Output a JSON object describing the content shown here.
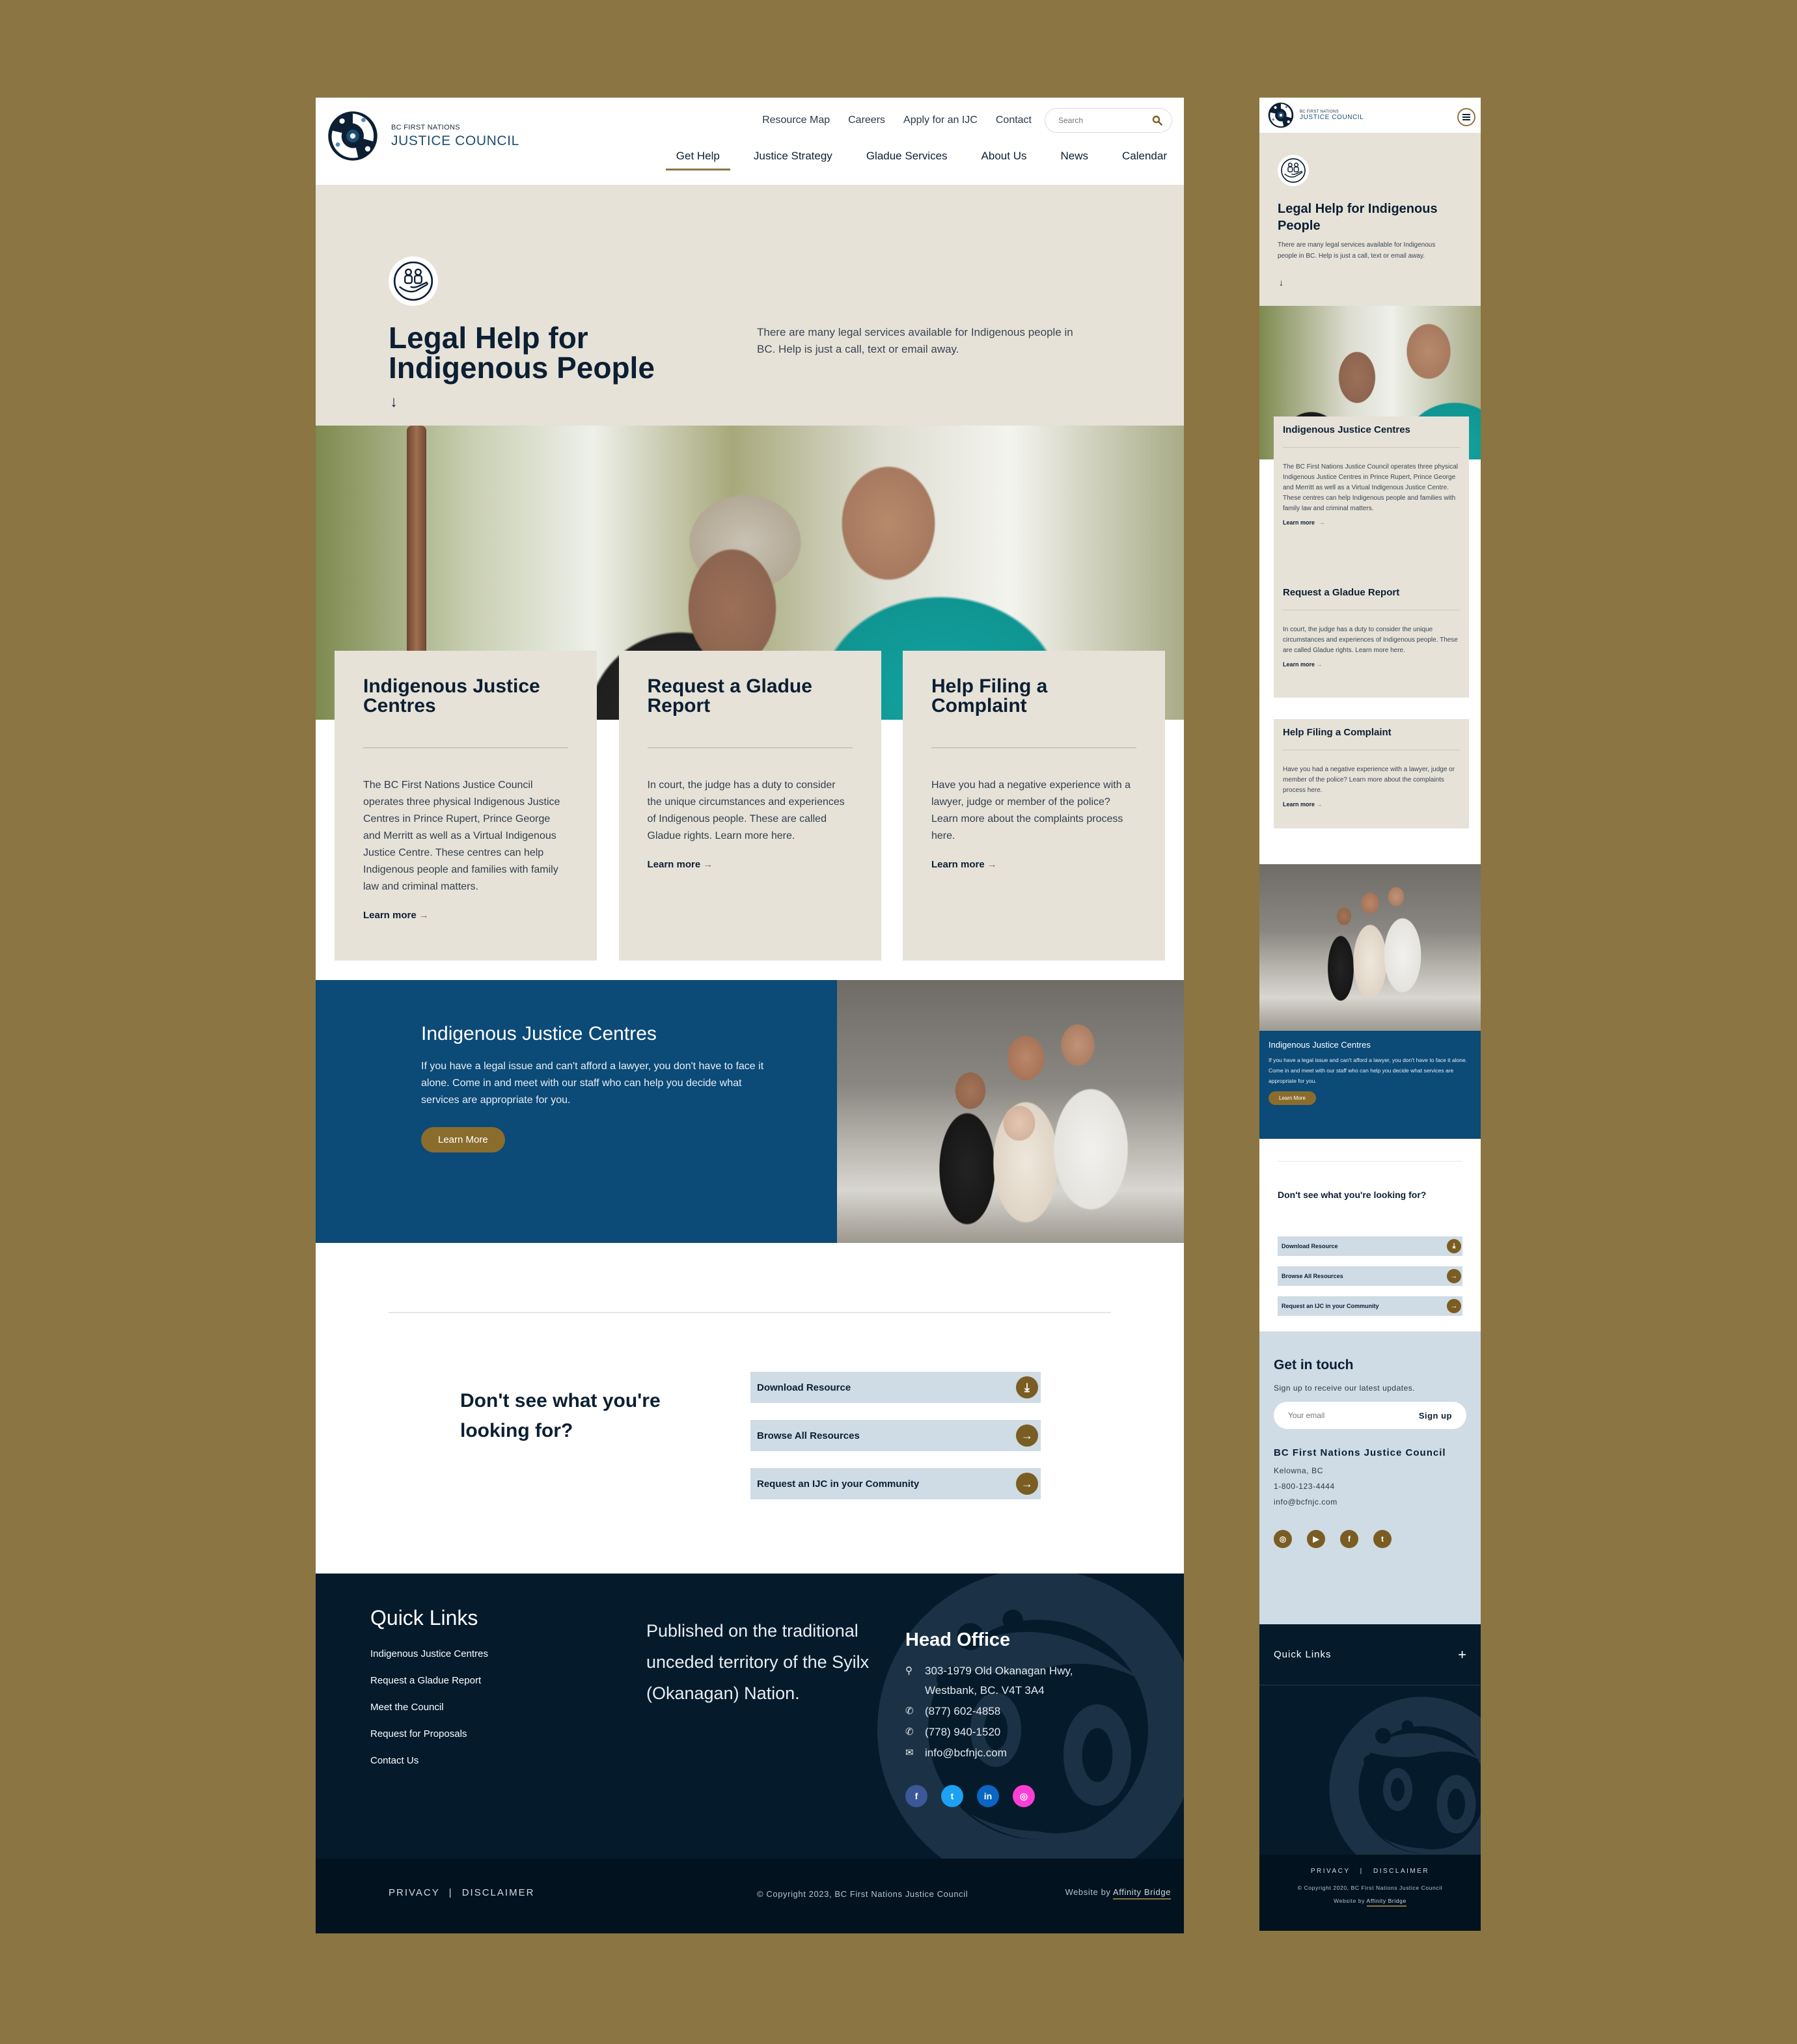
{
  "brand": {
    "line1": "BC FIRST NATIONS",
    "line2": "JUSTICE COUNCIL"
  },
  "colors": {
    "frame": "#8a7543",
    "navy": "#0c1f33",
    "blue_band": "#0c4a77",
    "beige": "#e6e2d8",
    "gold": "#8a6d2d",
    "light_blue": "#cfdbe5",
    "footer_dark": "#051b2c"
  },
  "utility_nav": [
    "Resource Map",
    "Careers",
    "Apply for an IJC",
    "Contact"
  ],
  "search": {
    "placeholder": "Search",
    "icon": "search-icon"
  },
  "main_nav": [
    {
      "label": "Get Help",
      "active": true
    },
    {
      "label": "Justice Strategy",
      "active": false
    },
    {
      "label": "Gladue Services",
      "active": false
    },
    {
      "label": "About Us",
      "active": false
    },
    {
      "label": "News",
      "active": false
    },
    {
      "label": "Calendar",
      "active": false
    }
  ],
  "hero": {
    "icon": "hands-people-icon",
    "title": "Legal Help for Indigenous People",
    "text": "There are many legal services available for Indigenous people in BC. Help is just a call, text or email away.",
    "arrow": "↓"
  },
  "cards": [
    {
      "title": "Indigenous Justice Centres",
      "text": "The BC First Nations Justice Council operates three physical Indigenous Justice Centres in Prince Rupert, Prince George and Merritt as well as a Virtual Indigenous Justice Centre. These centres can help Indigenous people and families with family law and criminal matters.",
      "link": "Learn more"
    },
    {
      "title": "Request a Gladue Report",
      "text": "In court, the judge has a duty to consider the unique circumstances and experiences of Indigenous people. These are called Gladue rights. Learn more here.",
      "link": "Learn more"
    },
    {
      "title": "Help Filing a Complaint",
      "text": "Have you had a negative experience with a lawyer, judge or member of the police? Learn more about the complaints process here.",
      "link": "Learn more"
    }
  ],
  "arrow_glyph": "→",
  "feature": {
    "title": "Indigenous Justice Centres",
    "text": "If you have a legal issue and can't afford a lawyer, you don't have to face it alone. Come in and meet with our staff who can help you decide what services are appropriate for you.",
    "button": "Learn More"
  },
  "cta": {
    "title": "Don't see what you're looking for?",
    "items": [
      {
        "label": "Download Resource",
        "icon": "download-icon",
        "glyph": "⤓"
      },
      {
        "label": "Browse All Resources",
        "icon": "arrow-right-icon",
        "glyph": "→"
      },
      {
        "label": "Request an IJC in your Community",
        "icon": "arrow-right-icon",
        "glyph": "→"
      }
    ]
  },
  "footer": {
    "quick_links_title": "Quick Links",
    "quick_links": [
      "Indigenous Justice Centres",
      "Request a Gladue Report",
      "Meet the Council",
      "Request for Proposals",
      "Contact Us"
    ],
    "acknowledgement": "Published on the traditional unceded territory of the Syilx (Okanagan) Nation.",
    "head_office_title": "Head Office",
    "address": "303-1979 Old Okanagan Hwy, Westbank, BC. V4T 3A4",
    "phone1": "(877) 602-4858",
    "phone2": "(778) 940-1520",
    "email": "info@bcfnjc.com",
    "socials": [
      {
        "name": "facebook",
        "glyph": "f",
        "color": "#3b5998"
      },
      {
        "name": "twitter",
        "glyph": "t",
        "color": "#1da1f2"
      },
      {
        "name": "linkedin",
        "glyph": "in",
        "color": "#0a66c2"
      },
      {
        "name": "instagram",
        "glyph": "◎",
        "color": "#ff3fd4"
      }
    ],
    "privacy": "PRIVACY",
    "separator": "|",
    "disclaimer": "DISCLAIMER",
    "copyright": "© Copyright 2023, BC First Nations Justice Council",
    "website_by": "Website by",
    "website_by_link": "Affinity Bridge"
  },
  "mobile": {
    "menu_icon": "hamburger-icon",
    "get_in_touch": {
      "title": "Get in touch",
      "subtitle": "Sign up to receive our latest updates.",
      "email_placeholder": "Your email",
      "signup": "Sign up",
      "org": "BC First Nations Justice Council",
      "location": "Kelowna, BC",
      "phone": "1-800-123-4444",
      "email": "info@bcfnjc.com",
      "socials": [
        {
          "name": "instagram",
          "glyph": "◎"
        },
        {
          "name": "youtube",
          "glyph": "▶"
        },
        {
          "name": "facebook",
          "glyph": "f"
        },
        {
          "name": "twitter",
          "glyph": "t"
        }
      ]
    },
    "quick_links_title": "Quick Links",
    "quick_links_toggle": "+",
    "copyright": "© Copyright 2020, BC First Nations Justice Council"
  }
}
